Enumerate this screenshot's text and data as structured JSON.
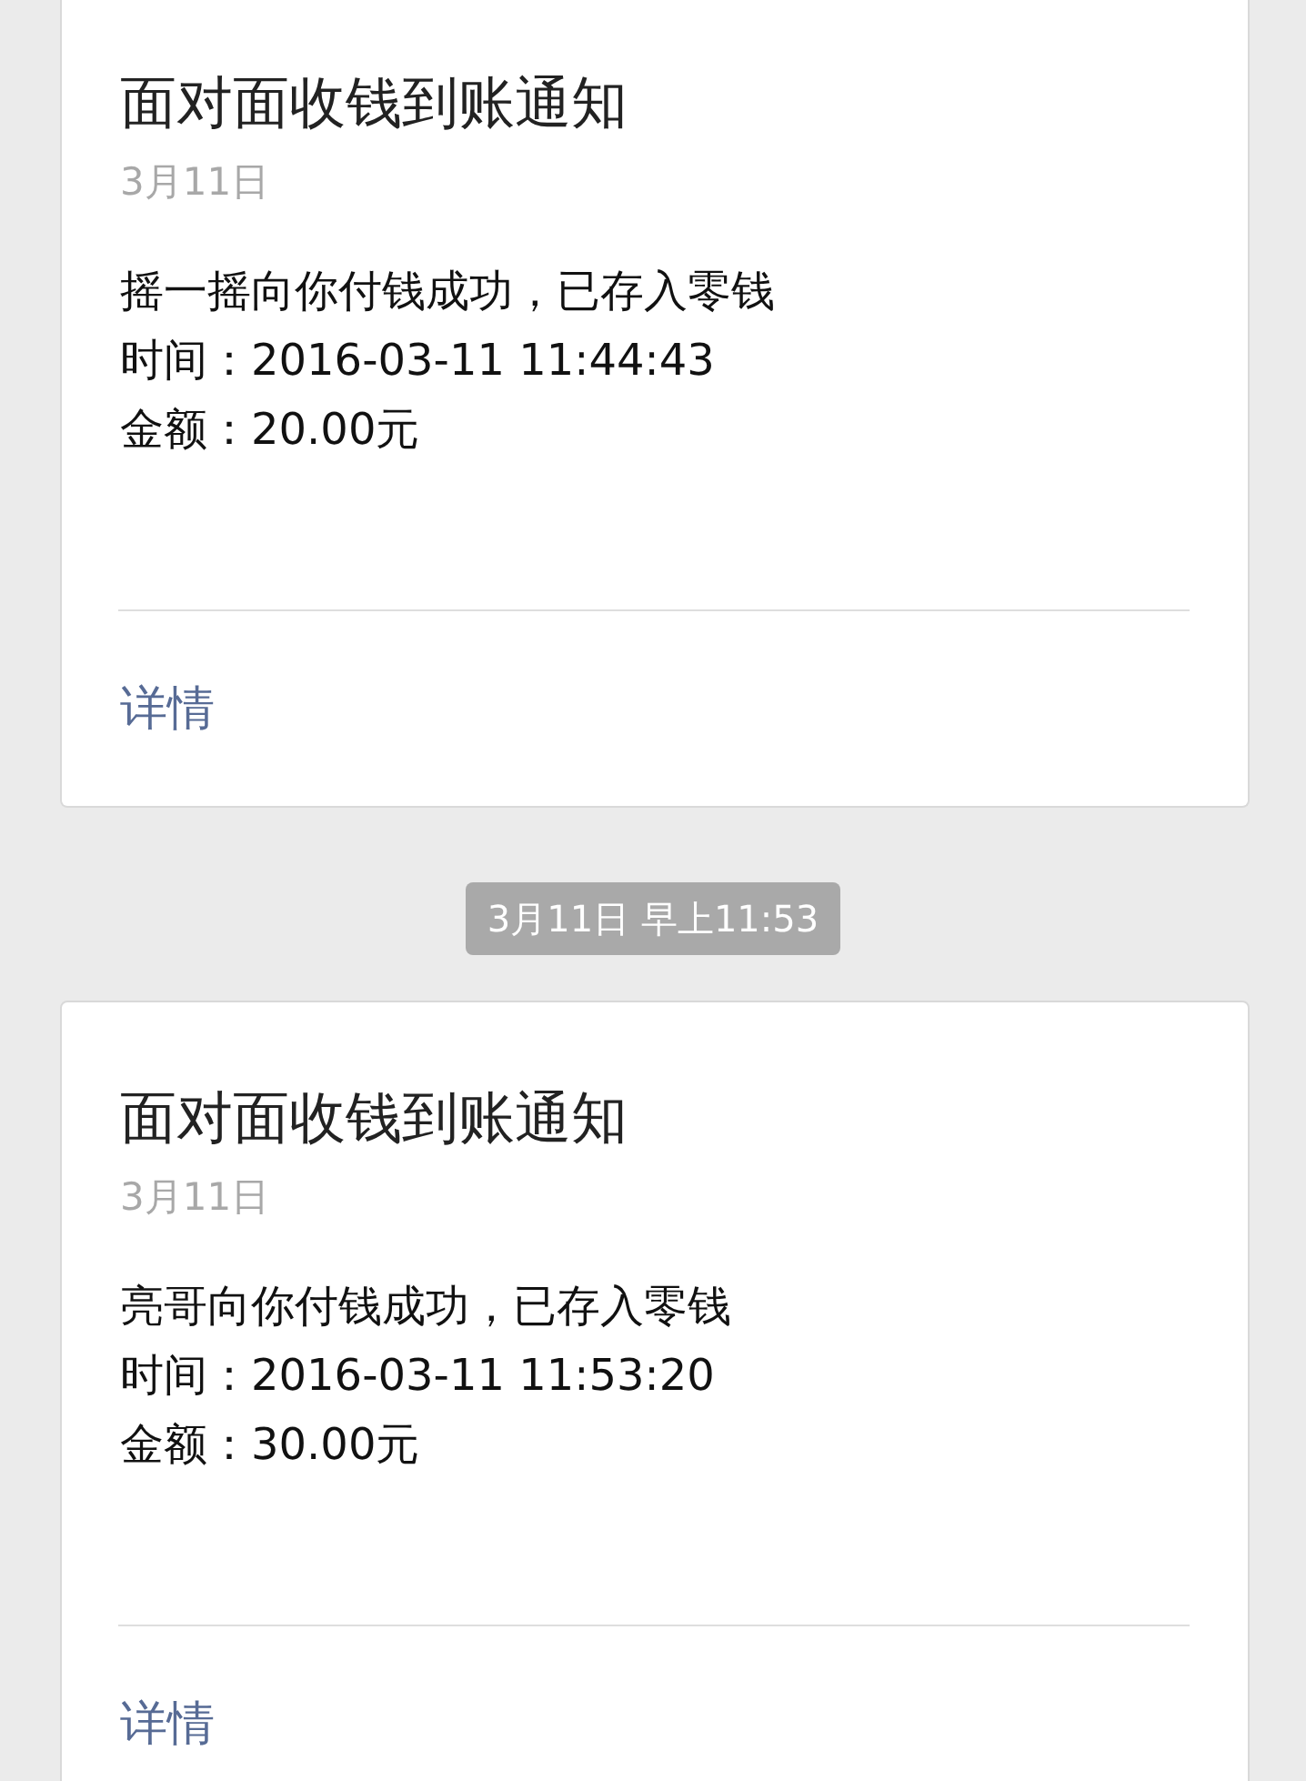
{
  "feed": [
    {
      "kind": "card",
      "title": "面对面收钱到账通知",
      "date": "3月11日",
      "lines": [
        "摇一摇向你付钱成功，已存入零钱",
        "时间：2016-03-11 11:44:43",
        "金额：20.00元"
      ],
      "link": "详情"
    },
    {
      "kind": "timestamp",
      "text": "3月11日 早上11:53"
    },
    {
      "kind": "card",
      "title": "面对面收钱到账通知",
      "date": "3月11日",
      "lines": [
        "亮哥向你付钱成功，已存入零钱",
        "时间：2016-03-11 11:53:20",
        "金额：30.00元"
      ],
      "link": "详情"
    }
  ]
}
